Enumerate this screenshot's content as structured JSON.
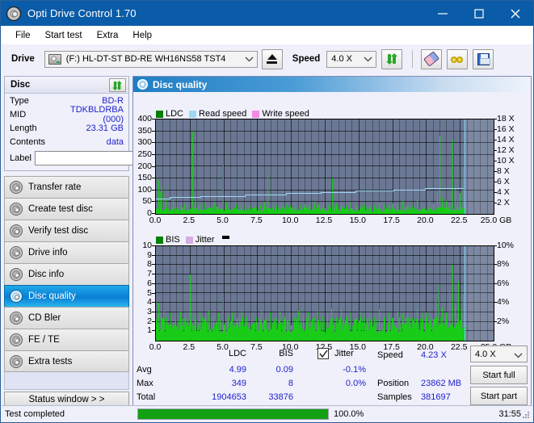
{
  "window": {
    "title": "Opti Drive Control 1.70",
    "icon": "disc-icon",
    "minimize": "minimize-icon",
    "maximize": "maximize-icon",
    "close": "close-icon"
  },
  "menu": {
    "items": [
      "File",
      "Start test",
      "Extra",
      "Help"
    ]
  },
  "toolbar": {
    "drive_label": "Drive",
    "drive_value": "(F:)  HL-DT-ST BD-RE  WH16NS58 TST4",
    "eject_label": "eject-icon",
    "speed_label": "Speed",
    "speed_value": "4.0 X",
    "refresh_label": "refresh-icon",
    "erase_label": "erase-icon",
    "glasses_label": "glasses-icon",
    "save_label": "save-icon"
  },
  "disc": {
    "header": "Disc",
    "refresh": "refresh-icon",
    "rows": [
      {
        "key": "Type",
        "value": "BD-R"
      },
      {
        "key": "MID",
        "value": "TDKBLDRBA (000)"
      },
      {
        "key": "Length",
        "value": "23.31 GB"
      },
      {
        "key": "Contents",
        "value": "data"
      }
    ],
    "label_key": "Label",
    "label_value": "",
    "label_placeholder": ""
  },
  "sidebar": {
    "items": [
      {
        "label": "Transfer rate",
        "active": false
      },
      {
        "label": "Create test disc",
        "active": false
      },
      {
        "label": "Verify test disc",
        "active": false
      },
      {
        "label": "Drive info",
        "active": false
      },
      {
        "label": "Disc info",
        "active": false
      },
      {
        "label": "Disc quality",
        "active": true
      },
      {
        "label": "CD Bler",
        "active": false
      },
      {
        "label": "FE / TE",
        "active": false
      },
      {
        "label": "Extra tests",
        "active": false
      }
    ],
    "status_window": "Status window > >"
  },
  "main": {
    "title": "Disc quality",
    "icon": "disc-quality-icon"
  },
  "stats": {
    "col_ldc": "LDC",
    "col_bis": "BIS",
    "row_avg": "Avg",
    "row_max": "Max",
    "row_total": "Total",
    "avg_ldc": "4.99",
    "avg_bis": "0.09",
    "max_ldc": "349",
    "max_bis": "8",
    "total_ldc": "1904653",
    "total_bis": "33876",
    "jitter_label": "Jitter",
    "jitter_checked": true,
    "jitter_avg": "-0.1%",
    "jitter_max": "0.0%",
    "speed_label": "Speed",
    "speed_value": "4.23 X",
    "position_label": "Position",
    "position_value": "23862 MB",
    "samples_label": "Samples",
    "samples_value": "381697",
    "speed_select": "4.0 X",
    "start_full": "Start full",
    "start_part": "Start part"
  },
  "statusbar": {
    "text": "Test completed",
    "progress_pct": "100.0%",
    "progress_value": 100,
    "elapsed": "31:55"
  },
  "colors": {
    "accent": "#0a5ca8",
    "ldc": "#18cc18",
    "bis": "#18cc18",
    "read_speed": "#9fd8f5",
    "write_speed": "#f58ae6",
    "jitter": "#d4aee0",
    "plot_bg": "#6b7894",
    "value_text": "#2222cc",
    "progress": "#13a013"
  },
  "chart_data": [
    {
      "type": "bar",
      "name": "top-chart",
      "title": "",
      "legend": [
        {
          "label": "LDC",
          "color": "#008000"
        },
        {
          "label": "Read speed",
          "color": "#9fd8f5"
        },
        {
          "label": "Write speed",
          "color": "#f58ae6"
        }
      ],
      "legend_position": "top-left",
      "xlabel": "GB",
      "ylabel": "LDC",
      "y2label": "X",
      "xlim": [
        0,
        25
      ],
      "ylim": [
        0,
        400
      ],
      "y2lim": [
        0,
        18
      ],
      "grid": true,
      "yticks": [
        0,
        50,
        100,
        150,
        200,
        250,
        300,
        350,
        400
      ],
      "ytick_labels": [
        "0",
        "50",
        "100",
        "150",
        "200",
        "250",
        "300",
        "350",
        "400"
      ],
      "y2ticks": [
        2,
        4,
        6,
        8,
        10,
        12,
        14,
        16,
        18
      ],
      "y2tick_labels": [
        "2 X",
        "4 X",
        "6 X",
        "8 X",
        "10 X",
        "12 X",
        "14 X",
        "16 X",
        "18 X"
      ],
      "xticks": [
        0,
        2.5,
        5,
        7.5,
        10,
        12.5,
        15,
        17.5,
        20,
        22.5,
        25
      ],
      "xtick_labels": [
        "0.0",
        "2.5",
        "5.0",
        "7.5",
        "10.0",
        "12.5",
        "15.0",
        "17.5",
        "20.0",
        "22.5",
        "25.0 GB"
      ],
      "data_end_x": 22.8,
      "cursor_x": 22.85,
      "series": [
        {
          "name": "LDC",
          "color": "#18cc18",
          "baseline": 22,
          "spikes": [
            {
              "x": 0.18,
              "y": 145
            },
            {
              "x": 0.3,
              "y": 92
            },
            {
              "x": 0.42,
              "y": 118
            },
            {
              "x": 0.55,
              "y": 60
            },
            {
              "x": 0.7,
              "y": 70
            },
            {
              "x": 0.95,
              "y": 48
            },
            {
              "x": 1.25,
              "y": 58
            },
            {
              "x": 1.55,
              "y": 44
            },
            {
              "x": 1.85,
              "y": 52
            },
            {
              "x": 2.1,
              "y": 40
            },
            {
              "x": 2.45,
              "y": 45
            },
            {
              "x": 2.7,
              "y": 349
            },
            {
              "x": 2.95,
              "y": 55
            },
            {
              "x": 3.25,
              "y": 42
            },
            {
              "x": 3.6,
              "y": 48
            },
            {
              "x": 3.95,
              "y": 38
            },
            {
              "x": 4.3,
              "y": 44
            },
            {
              "x": 4.65,
              "y": 40
            },
            {
              "x": 4.95,
              "y": 205
            },
            {
              "x": 5.2,
              "y": 52
            },
            {
              "x": 5.55,
              "y": 40
            },
            {
              "x": 5.9,
              "y": 46
            },
            {
              "x": 6.25,
              "y": 38
            },
            {
              "x": 6.6,
              "y": 44
            },
            {
              "x": 6.95,
              "y": 36
            },
            {
              "x": 7.35,
              "y": 42
            },
            {
              "x": 7.7,
              "y": 38
            },
            {
              "x": 8.0,
              "y": 52
            },
            {
              "x": 8.25,
              "y": 168
            },
            {
              "x": 8.55,
              "y": 44
            },
            {
              "x": 8.9,
              "y": 38
            },
            {
              "x": 9.25,
              "y": 46
            },
            {
              "x": 9.6,
              "y": 40
            },
            {
              "x": 9.95,
              "y": 36
            },
            {
              "x": 10.3,
              "y": 44
            },
            {
              "x": 10.65,
              "y": 38
            },
            {
              "x": 11.0,
              "y": 42
            },
            {
              "x": 11.35,
              "y": 36
            },
            {
              "x": 11.7,
              "y": 48
            },
            {
              "x": 12.05,
              "y": 40
            },
            {
              "x": 12.4,
              "y": 44
            },
            {
              "x": 12.75,
              "y": 38
            },
            {
              "x": 13.05,
              "y": 150
            },
            {
              "x": 13.35,
              "y": 46
            },
            {
              "x": 13.7,
              "y": 40
            },
            {
              "x": 14.05,
              "y": 36
            },
            {
              "x": 14.4,
              "y": 52
            },
            {
              "x": 14.75,
              "y": 42
            },
            {
              "x": 15.1,
              "y": 38
            },
            {
              "x": 15.45,
              "y": 46
            },
            {
              "x": 15.8,
              "y": 40
            },
            {
              "x": 16.15,
              "y": 36
            },
            {
              "x": 16.5,
              "y": 48
            },
            {
              "x": 16.85,
              "y": 42
            },
            {
              "x": 17.2,
              "y": 38
            },
            {
              "x": 17.55,
              "y": 44
            },
            {
              "x": 17.9,
              "y": 40
            },
            {
              "x": 18.25,
              "y": 55
            },
            {
              "x": 18.6,
              "y": 42
            },
            {
              "x": 18.95,
              "y": 38
            },
            {
              "x": 19.3,
              "y": 62
            },
            {
              "x": 19.6,
              "y": 48
            },
            {
              "x": 19.9,
              "y": 44
            },
            {
              "x": 20.2,
              "y": 58
            },
            {
              "x": 20.5,
              "y": 40
            },
            {
              "x": 20.8,
              "y": 95
            },
            {
              "x": 21.0,
              "y": 330
            },
            {
              "x": 21.2,
              "y": 70
            },
            {
              "x": 21.45,
              "y": 55
            },
            {
              "x": 21.7,
              "y": 48
            },
            {
              "x": 21.95,
              "y": 315
            },
            {
              "x": 22.1,
              "y": 120
            },
            {
              "x": 22.3,
              "y": 60
            },
            {
              "x": 22.5,
              "y": 88
            },
            {
              "x": 22.7,
              "y": 200
            }
          ]
        },
        {
          "name": "Read speed",
          "color": "#9fd8f5",
          "steps": [
            {
              "x0": 0.0,
              "x1": 1.0,
              "y": 2.7
            },
            {
              "x0": 1.0,
              "x1": 3.3,
              "y": 3.1
            },
            {
              "x0": 3.3,
              "x1": 6.6,
              "y": 3.3
            },
            {
              "x0": 6.6,
              "x1": 9.6,
              "y": 3.5
            },
            {
              "x0": 9.6,
              "x1": 12.2,
              "y": 3.8
            },
            {
              "x0": 12.2,
              "x1": 14.8,
              "y": 4.0
            },
            {
              "x0": 14.8,
              "x1": 17.6,
              "y": 4.3
            },
            {
              "x0": 17.6,
              "x1": 19.9,
              "y": 4.5
            },
            {
              "x0": 19.9,
              "x1": 22.8,
              "y": 4.7
            }
          ]
        }
      ]
    },
    {
      "type": "bar",
      "name": "bottom-chart",
      "title": "",
      "legend": [
        {
          "label": "BIS",
          "color": "#008000"
        },
        {
          "label": "Jitter",
          "color": "#d4aee0"
        }
      ],
      "legend_position": "top-left",
      "xlabel": "GB",
      "ylabel": "BIS",
      "y2label": "%",
      "xlim": [
        0,
        25
      ],
      "ylim": [
        0,
        10
      ],
      "y2lim": [
        0,
        10
      ],
      "grid": true,
      "yticks": [
        1,
        2,
        3,
        4,
        5,
        6,
        7,
        8,
        9,
        10
      ],
      "ytick_labels": [
        "1",
        "2",
        "3",
        "4",
        "5",
        "6",
        "7",
        "8",
        "9",
        "10"
      ],
      "y2ticks": [
        2,
        4,
        6,
        8,
        10
      ],
      "y2tick_labels": [
        "2%",
        "4%",
        "6%",
        "8%",
        "10%"
      ],
      "xticks": [
        0,
        2.5,
        5,
        7.5,
        10,
        12.5,
        15,
        17.5,
        20,
        22.5,
        25
      ],
      "xtick_labels": [
        "0.0",
        "2.5",
        "5.0",
        "7.5",
        "10.0",
        "12.5",
        "15.0",
        "17.5",
        "20.0",
        "22.5",
        "25.0 GB"
      ],
      "data_end_x": 22.8,
      "cursor_x": 22.85,
      "series": [
        {
          "name": "BIS",
          "color": "#18cc18",
          "baseline": 1.8,
          "spikes": [
            {
              "x": 0.2,
              "y": 4.0
            },
            {
              "x": 0.35,
              "y": 3.0
            },
            {
              "x": 0.55,
              "y": 3.2
            },
            {
              "x": 0.8,
              "y": 2.6
            },
            {
              "x": 1.1,
              "y": 3.0
            },
            {
              "x": 1.45,
              "y": 2.4
            },
            {
              "x": 1.8,
              "y": 3.1
            },
            {
              "x": 2.15,
              "y": 2.5
            },
            {
              "x": 2.5,
              "y": 7.0
            },
            {
              "x": 2.85,
              "y": 2.8
            },
            {
              "x": 3.2,
              "y": 3.0
            },
            {
              "x": 3.55,
              "y": 2.4
            },
            {
              "x": 3.9,
              "y": 3.2
            },
            {
              "x": 4.25,
              "y": 2.6
            },
            {
              "x": 4.6,
              "y": 2.9
            },
            {
              "x": 4.95,
              "y": 5.0
            },
            {
              "x": 5.3,
              "y": 2.6
            },
            {
              "x": 5.65,
              "y": 3.0
            },
            {
              "x": 6.0,
              "y": 2.4
            },
            {
              "x": 6.35,
              "y": 3.1
            },
            {
              "x": 6.7,
              "y": 2.6
            },
            {
              "x": 7.05,
              "y": 3.0
            },
            {
              "x": 7.4,
              "y": 2.5
            },
            {
              "x": 7.75,
              "y": 3.2
            },
            {
              "x": 8.1,
              "y": 2.6
            },
            {
              "x": 8.45,
              "y": 3.0
            },
            {
              "x": 8.8,
              "y": 2.4
            },
            {
              "x": 9.15,
              "y": 3.1
            },
            {
              "x": 9.5,
              "y": 2.6
            },
            {
              "x": 9.85,
              "y": 3.0
            },
            {
              "x": 10.2,
              "y": 2.5
            },
            {
              "x": 10.55,
              "y": 3.2
            },
            {
              "x": 10.9,
              "y": 2.6
            },
            {
              "x": 11.25,
              "y": 3.0
            },
            {
              "x": 11.6,
              "y": 2.4
            },
            {
              "x": 11.95,
              "y": 3.1
            },
            {
              "x": 12.3,
              "y": 2.6
            },
            {
              "x": 12.65,
              "y": 3.0
            },
            {
              "x": 13.0,
              "y": 3.4
            },
            {
              "x": 13.35,
              "y": 2.5
            },
            {
              "x": 13.7,
              "y": 3.2
            },
            {
              "x": 14.05,
              "y": 2.6
            },
            {
              "x": 14.4,
              "y": 3.0
            },
            {
              "x": 14.75,
              "y": 2.4
            },
            {
              "x": 15.1,
              "y": 3.1
            },
            {
              "x": 15.45,
              "y": 2.6
            },
            {
              "x": 15.8,
              "y": 3.0
            },
            {
              "x": 16.15,
              "y": 2.5
            },
            {
              "x": 16.5,
              "y": 3.3
            },
            {
              "x": 16.85,
              "y": 2.6
            },
            {
              "x": 17.2,
              "y": 3.0
            },
            {
              "x": 17.55,
              "y": 2.4
            },
            {
              "x": 17.9,
              "y": 3.1
            },
            {
              "x": 18.25,
              "y": 2.8
            },
            {
              "x": 18.6,
              "y": 3.0
            },
            {
              "x": 18.95,
              "y": 2.5
            },
            {
              "x": 19.3,
              "y": 3.4
            },
            {
              "x": 19.65,
              "y": 2.8
            },
            {
              "x": 20.0,
              "y": 3.0
            },
            {
              "x": 20.35,
              "y": 2.6
            },
            {
              "x": 20.7,
              "y": 4.2
            },
            {
              "x": 20.95,
              "y": 6.0
            },
            {
              "x": 21.2,
              "y": 3.6
            },
            {
              "x": 21.45,
              "y": 3.0
            },
            {
              "x": 21.7,
              "y": 5.2
            },
            {
              "x": 21.95,
              "y": 8.0
            },
            {
              "x": 22.15,
              "y": 4.0
            },
            {
              "x": 22.35,
              "y": 6.2
            },
            {
              "x": 22.55,
              "y": 3.4
            },
            {
              "x": 22.7,
              "y": 5.0
            }
          ]
        }
      ]
    }
  ]
}
